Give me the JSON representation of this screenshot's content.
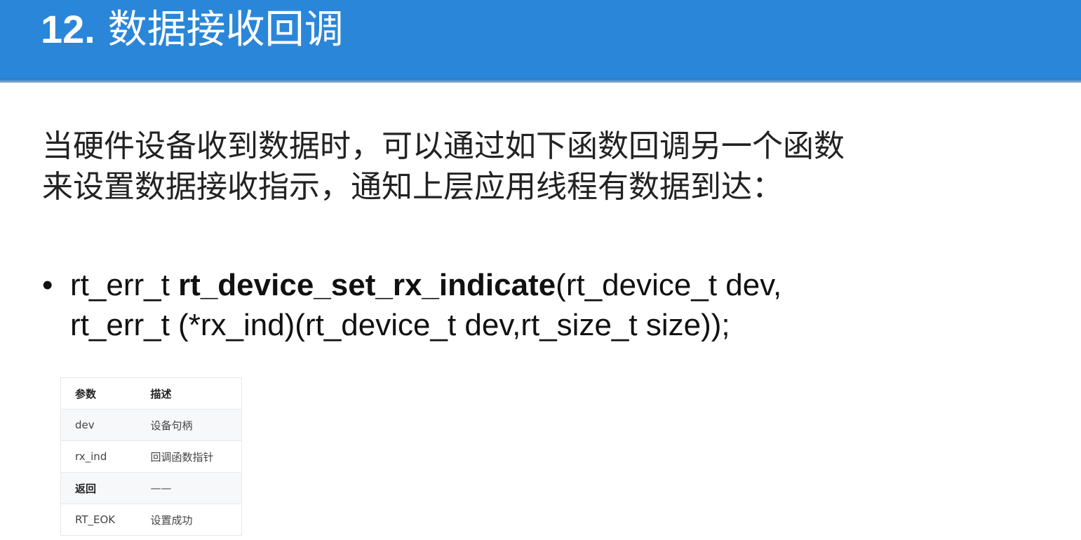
{
  "title": {
    "number": "12.",
    "text": "数据接收回调"
  },
  "intro": {
    "line1": "当硬件设备收到数据时，可以通过如下函数回调另一个函数",
    "line2": "来设置数据接收指示，通知上层应用线程有数据到达："
  },
  "bullet": {
    "marker": "•",
    "return_type": "rt_err_t",
    "function_name": "rt_device_set_rx_indicate",
    "params_part1": "(rt_device_t dev,",
    "params_part2": "rt_err_t (*rx_ind)(rt_device_t dev,rt_size_t size));"
  },
  "table": {
    "headers": [
      "参数",
      "描述"
    ],
    "rows": [
      [
        "dev",
        "设备句柄"
      ],
      [
        "rx_ind",
        "回调函数指针"
      ],
      [
        "返回",
        "——"
      ],
      [
        "RT_EOK",
        "设置成功"
      ]
    ]
  },
  "colors": {
    "title_bar": "#2a86d9",
    "title_text": "#ffffff",
    "body_text": "#222222"
  }
}
